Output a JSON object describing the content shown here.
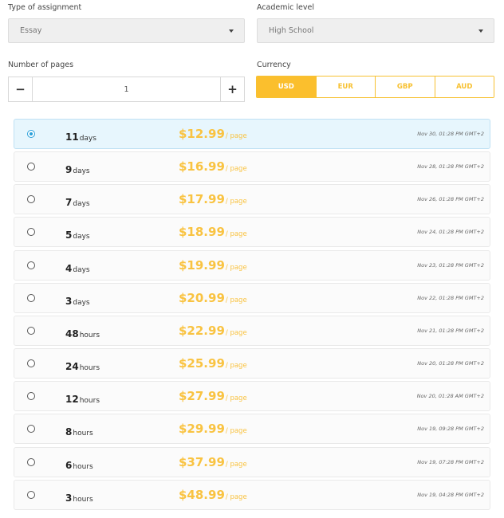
{
  "type_of_assignment": {
    "label": "Type of assignment",
    "value": "Essay"
  },
  "academic_level": {
    "label": "Academic level",
    "value": "High School"
  },
  "pages": {
    "label": "Number of pages",
    "value": "1",
    "minus": "−",
    "plus": "+"
  },
  "currency": {
    "label": "Currency",
    "options": [
      "USD",
      "EUR",
      "GBP",
      "AUD"
    ],
    "selected": "USD"
  },
  "deadlines": [
    {
      "num": "11",
      "unit": "days",
      "price": "$12.99",
      "per": "/ page",
      "deadline": "Nov 30, 01:28 PM GMT+2",
      "selected": true
    },
    {
      "num": "9",
      "unit": "days",
      "price": "$16.99",
      "per": "/ page",
      "deadline": "Nov 28, 01:28 PM GMT+2",
      "selected": false
    },
    {
      "num": "7",
      "unit": "days",
      "price": "$17.99",
      "per": "/ page",
      "deadline": "Nov 26, 01:28 PM GMT+2",
      "selected": false
    },
    {
      "num": "5",
      "unit": "days",
      "price": "$18.99",
      "per": "/ page",
      "deadline": "Nov 24, 01:28 PM GMT+2",
      "selected": false
    },
    {
      "num": "4",
      "unit": "days",
      "price": "$19.99",
      "per": "/ page",
      "deadline": "Nov 23, 01:28 PM GMT+2",
      "selected": false
    },
    {
      "num": "3",
      "unit": "days",
      "price": "$20.99",
      "per": "/ page",
      "deadline": "Nov 22, 01:28 PM GMT+2",
      "selected": false
    },
    {
      "num": "48",
      "unit": "hours",
      "price": "$22.99",
      "per": "/ page",
      "deadline": "Nov 21, 01:28 PM GMT+2",
      "selected": false
    },
    {
      "num": "24",
      "unit": "hours",
      "price": "$25.99",
      "per": "/ page",
      "deadline": "Nov 20, 01:28 PM GMT+2",
      "selected": false
    },
    {
      "num": "12",
      "unit": "hours",
      "price": "$27.99",
      "per": "/ page",
      "deadline": "Nov 20, 01:28 AM GMT+2",
      "selected": false
    },
    {
      "num": "8",
      "unit": "hours",
      "price": "$29.99",
      "per": "/ page",
      "deadline": "Nov 19, 09:28 PM GMT+2",
      "selected": false
    },
    {
      "num": "6",
      "unit": "hours",
      "price": "$37.99",
      "per": "/ page",
      "deadline": "Nov 19, 07:28 PM GMT+2",
      "selected": false
    },
    {
      "num": "3",
      "unit": "hours",
      "price": "$48.99",
      "per": "/ page",
      "deadline": "Nov 19, 04:28 PM GMT+2",
      "selected": false
    }
  ],
  "icons": {
    "dropdown": "chevron-down-icon",
    "radio": "radio-icon"
  },
  "colors": {
    "accent": "#fbbf2d",
    "selected_row": "#e7f6fd",
    "radio_selected": "#2aa0da"
  }
}
